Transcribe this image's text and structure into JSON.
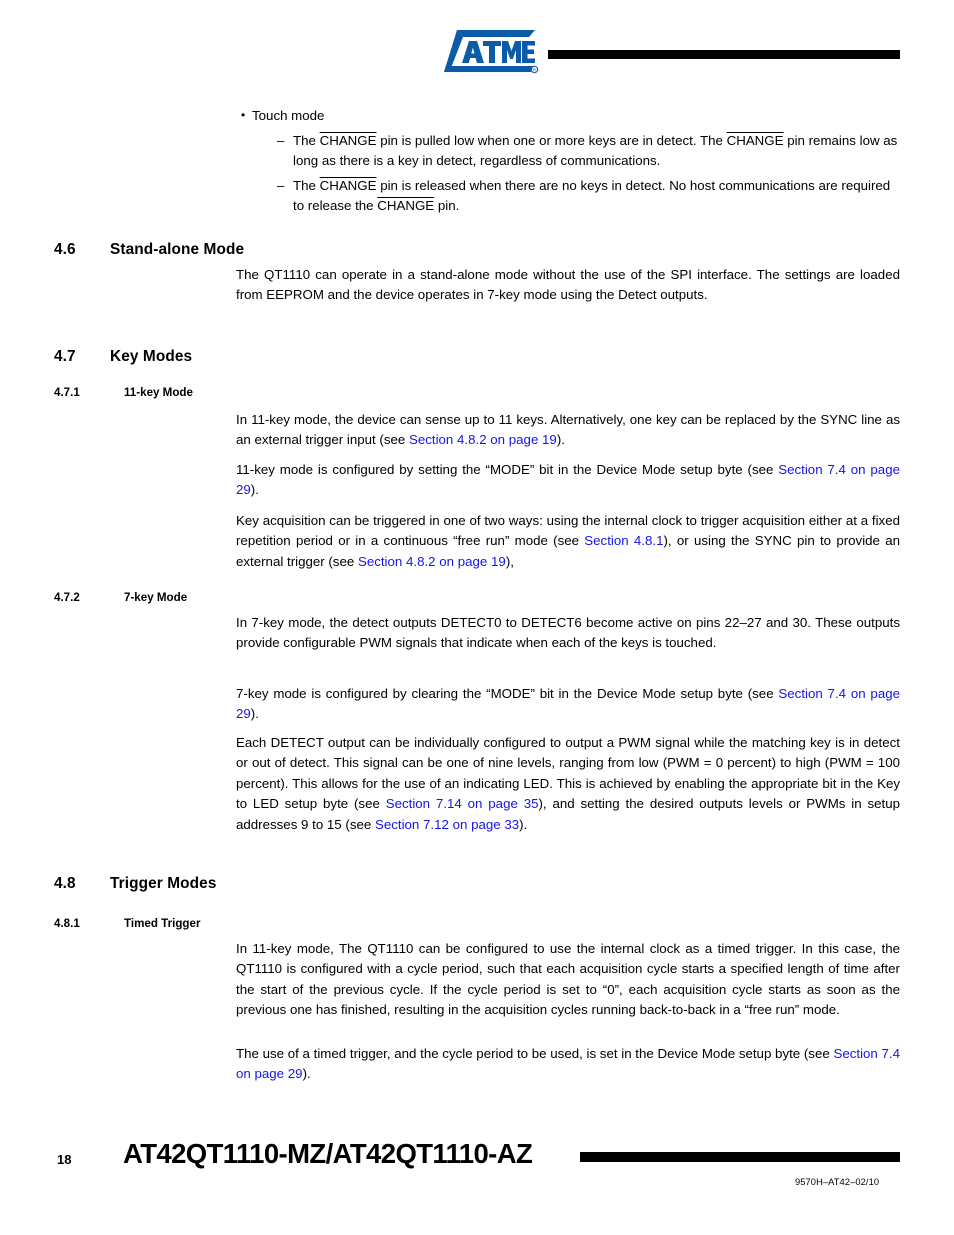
{
  "header": {
    "logo_alt": "ATMEL",
    "logo_color": "#0B5BA8",
    "rule_color": "#000000"
  },
  "link_color": "#1616E8",
  "top_bullets": {
    "item1": "Touch mode",
    "sub1_a": "The ",
    "sub1_overline1": "CHANGE",
    "sub1_b": " pin is pulled low when one or more keys are in detect. The ",
    "sub1_overline2": "CHANGE",
    "sub1_c": " pin remains low as long as there is a key in detect, regardless of communications.",
    "sub2_a": "The ",
    "sub2_overline1": "CHANGE",
    "sub2_b": " pin is released when there are no keys in detect. No host communications are required to release the ",
    "sub2_overline2": "CHANGE",
    "sub2_c": " pin."
  },
  "sections": {
    "s46": {
      "number": "4.6",
      "title": "Stand-alone Mode",
      "p1": "The QT1110 can operate in a stand-alone mode without the use of the SPI interface. The settings are loaded from EEPROM and the device operates in 7-key mode using the Detect outputs."
    },
    "s47": {
      "number": "4.7",
      "title": "Key Modes"
    },
    "s471": {
      "number": "4.7.1",
      "title": "11-key Mode",
      "p1_a": "In 11-key mode, the device can sense up to 11 keys. Alternatively, one key can be replaced by the SYNC line as an external trigger input (see ",
      "p1_link": "Section 4.8.2 on page 19",
      "p1_b": ").",
      "p2_a": "11-key mode is configured by setting the “MODE” bit in the Device Mode setup byte (see ",
      "p2_link": "Section 7.4 on page 29",
      "p2_b": ").",
      "p3_a": "Key acquisition can be triggered in one of two ways: using the internal clock to trigger acquisition either at a fixed repetition period or in a continuous “free run” mode (see ",
      "p3_link1": "Section 4.8.1",
      "p3_b": "), or using the SYNC pin to provide an external trigger (see ",
      "p3_link2": "Section 4.8.2 on page 19",
      "p3_c": "),"
    },
    "s472": {
      "number": "4.7.2",
      "title": "7-key Mode",
      "p1": "In 7-key mode, the detect outputs DETECT0 to DETECT6 become active on pins 22–27 and 30. These outputs provide configurable PWM signals that indicate when each of the keys is touched.",
      "p2_a": "7-key mode is configured by clearing the “MODE” bit in the Device Mode setup byte (see ",
      "p2_link": "Section 7.4 on page 29",
      "p2_b": ").",
      "p3_a": "Each DETECT output can be individually configured to output a PWM signal while the matching key is in detect or out of detect. This signal can be one of nine levels, ranging from low (PWM = 0 percent) to high (PWM = 100  percent). This allows for the use of an indicating LED. This is achieved by enabling the appropriate bit in the Key to LED setup byte (see ",
      "p3_link1": "Section 7.14 on page 35",
      "p3_b": "), and setting the desired outputs levels or PWMs in setup addresses 9 to 15 (see ",
      "p3_link2": "Section 7.12 on page 33",
      "p3_c": ")."
    },
    "s48": {
      "number": "4.8",
      "title": "Trigger Modes"
    },
    "s481": {
      "number": "4.8.1",
      "title": "Timed Trigger",
      "p1": "In 11-key mode, The QT1110 can be configured to use the internal clock as a timed trigger. In this case, the QT1110 is configured with a cycle period, such that each acquisition cycle starts a specified length of time after the start of the previous cycle. If the cycle period is set to “0”, each acquisition cycle starts as soon as the previous one has finished, resulting in the acquisition cycles running back-to-back in a “free run” mode.",
      "p2_a": "The use of a timed trigger, and the cycle period to be used, is set in the Device Mode setup byte (see ",
      "p2_link": "Section 7.4 on page 29",
      "p2_b": ")."
    }
  },
  "footer": {
    "page_number": "18",
    "part_title": "AT42QT1110-MZ/AT42QT1110-AZ",
    "doc_code": "9570H–AT42–02/10"
  }
}
